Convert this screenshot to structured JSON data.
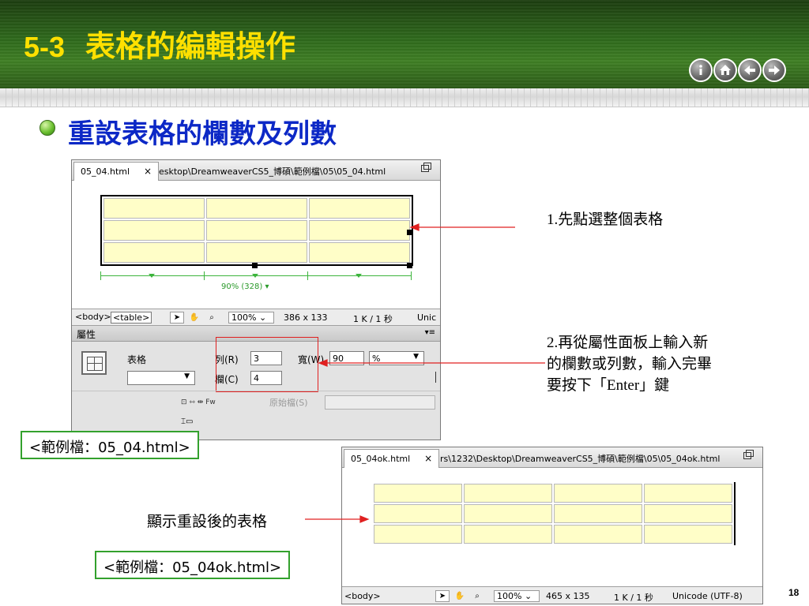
{
  "header": {
    "number": "5-3",
    "title": "表格的編輯操作",
    "nav_icons": [
      "info-icon",
      "home-icon",
      "back-icon",
      "forward-icon"
    ]
  },
  "slide": {
    "heading": "重設表格的欄數及列數",
    "page_number": "18"
  },
  "window1": {
    "tab_label": "05_04.html",
    "tab_close": "×",
    "path": "esktop\\DreamweaverCS5_博碩\\範例檔\\05\\05_04.html",
    "table_rows": 3,
    "table_cols": 3,
    "width_label": "90% (328) ▾",
    "status": {
      "tag_body": "<body>",
      "tag_table": "<table>",
      "zoom": "100%",
      "size": "386 x 133",
      "info": "1 K / 1 秒",
      "encoding": "Unic"
    },
    "properties": {
      "panel_title": "屬性",
      "menu_glyph": "▾≡",
      "table_label": "表格",
      "rows_label": "列(R)",
      "rows_value": "3",
      "cols_label": "欄(C)",
      "cols_value": "4",
      "width_label": "寬(W)",
      "width_value": "90",
      "unit_value": "%",
      "raw_label": "原始檔(S)",
      "small_icons": "⊡ ⇿ ⇹   Fw"
    }
  },
  "window2": {
    "tab_label": "05_04ok.html",
    "tab_close": "×",
    "path": "rs\\1232\\Desktop\\DreamweaverCS5_博碩\\範例檔\\05\\05_04ok.html",
    "table_rows": 3,
    "table_cols": 4,
    "status": {
      "tag_body": "<body>",
      "zoom": "100%",
      "size": "465 x 135",
      "info": "1 K / 1 秒",
      "encoding": "Unicode (UTF-8)"
    }
  },
  "annotations": {
    "step1": "1.先點選整個表格",
    "step2_line1": "2.再從屬性面板上輸入新",
    "step2_line2": "的欄數或列數，輸入完畢",
    "step2_line3": "要按下「Enter」鍵",
    "result": "顯示重設後的表格",
    "file1": "<範例檔：05_04.html>",
    "file2": "<範例檔：05_04ok.html>"
  },
  "colors": {
    "title": "#ffe000",
    "heading": "#0c28c6",
    "cell": "#fffec8",
    "annotation_arrow": "#e02020",
    "file_box_border": "#33a12d",
    "width_guide": "#3cb43c"
  }
}
